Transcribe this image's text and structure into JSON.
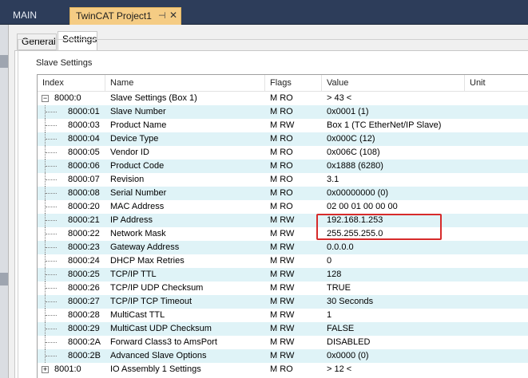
{
  "doc_tabs": {
    "inactive_label": "MAIN",
    "active_label": "TwinCAT Project1",
    "pin_glyph": "⊣",
    "close_glyph": "✕"
  },
  "sub_tabs": [
    "General",
    "Settings"
  ],
  "group_title": "Slave Settings",
  "columns": [
    "Index",
    "Name",
    "Flags",
    "Value",
    "Unit"
  ],
  "rows": [
    {
      "index": "8000:0",
      "name": "Slave Settings (Box 1)",
      "flags": "M RO",
      "value": "> 43 <",
      "expandable": "collapse"
    },
    {
      "index": "8000:01",
      "name": "Slave Number",
      "flags": "M RO",
      "value": "0x0001 (1)"
    },
    {
      "index": "8000:03",
      "name": "Product Name",
      "flags": "M RW",
      "value": "Box 1 (TC EtherNet/IP Slave)"
    },
    {
      "index": "8000:04",
      "name": "Device Type",
      "flags": "M RO",
      "value": "0x000C (12)"
    },
    {
      "index": "8000:05",
      "name": "Vendor ID",
      "flags": "M RO",
      "value": "0x006C (108)"
    },
    {
      "index": "8000:06",
      "name": "Product Code",
      "flags": "M RO",
      "value": "0x1888 (6280)"
    },
    {
      "index": "8000:07",
      "name": "Revision",
      "flags": "M RO",
      "value": "3.1"
    },
    {
      "index": "8000:08",
      "name": "Serial Number",
      "flags": "M RO",
      "value": "0x00000000 (0)"
    },
    {
      "index": "8000:20",
      "name": "MAC Address",
      "flags": "M RO",
      "value": "02 00 01 00 00 00"
    },
    {
      "index": "8000:21",
      "name": "IP Address",
      "flags": "M RW",
      "value": "192.168.1.253"
    },
    {
      "index": "8000:22",
      "name": "Network Mask",
      "flags": "M RW",
      "value": "255.255.255.0"
    },
    {
      "index": "8000:23",
      "name": "Gateway Address",
      "flags": "M RW",
      "value": "0.0.0.0"
    },
    {
      "index": "8000:24",
      "name": "DHCP Max Retries",
      "flags": "M RW",
      "value": "0"
    },
    {
      "index": "8000:25",
      "name": "TCP/IP TTL",
      "flags": "M RW",
      "value": "128"
    },
    {
      "index": "8000:26",
      "name": "TCP/IP UDP Checksum",
      "flags": "M RW",
      "value": "TRUE"
    },
    {
      "index": "8000:27",
      "name": "TCP/IP TCP Timeout",
      "flags": "M RW",
      "value": "30 Seconds"
    },
    {
      "index": "8000:28",
      "name": "MultiCast TTL",
      "flags": "M RW",
      "value": "1"
    },
    {
      "index": "8000:29",
      "name": "MultiCast UDP Checksum",
      "flags": "M RW",
      "value": "FALSE"
    },
    {
      "index": "8000:2A",
      "name": "Forward Class3 to AmsPort",
      "flags": "M RW",
      "value": "DISABLED"
    },
    {
      "index": "8000:2B",
      "name": "Advanced Slave Options",
      "flags": "M RW",
      "value": "0x0000 (0)"
    },
    {
      "index": "8001:0",
      "name": "IO Assembly 1 Settings",
      "flags": "M RO",
      "value": "> 12 <",
      "expandable": "expand"
    }
  ],
  "colors": {
    "row_alt": "#dff3f7",
    "active_tab": "#f5cc84",
    "highlight": "#d62b2b"
  }
}
